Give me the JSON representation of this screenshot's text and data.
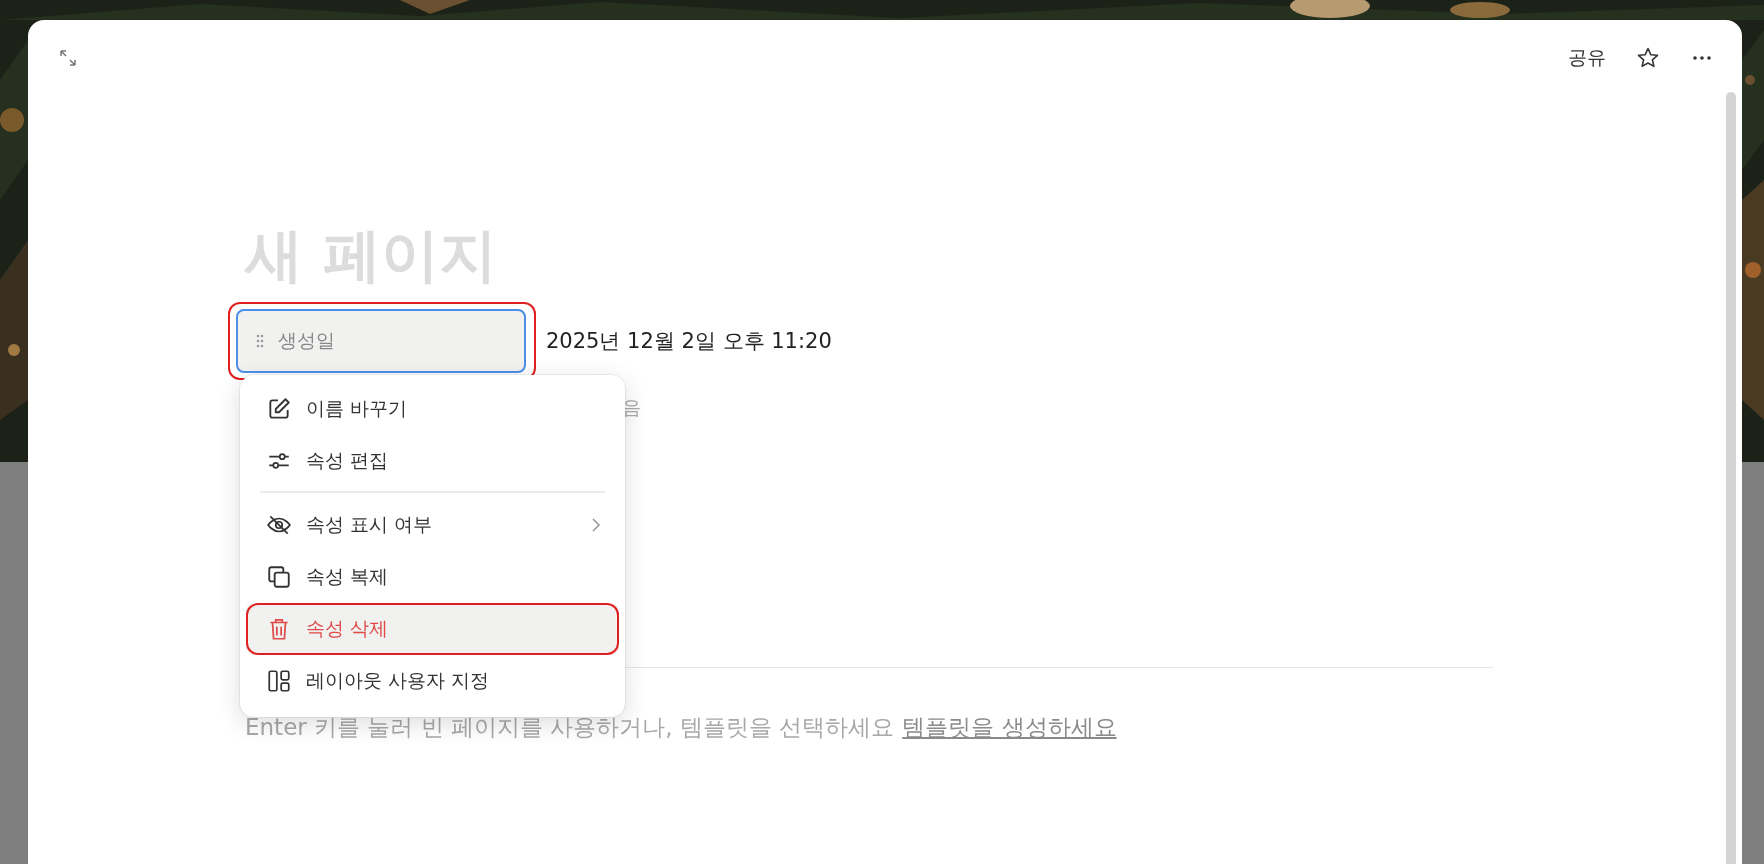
{
  "topbar": {
    "share": "공유"
  },
  "page": {
    "title": "새 페이지",
    "property": {
      "name": "생성일",
      "value": "2025년 12월 2일 오후 11:20",
      "focused": true,
      "highlighted": true
    },
    "hidden_fragment": "음",
    "hint": {
      "text": "Enter 키를 눌러 빈 페이지를 사용하거나, 템플릿을 선택하세요",
      "link": "템플릿을 생성하세요"
    }
  },
  "menu": {
    "sections": [
      {
        "items": [
          {
            "kind": "rename",
            "label": "이름 바꾸기",
            "selected": false,
            "highlighted": false,
            "submenu": false
          },
          {
            "kind": "edit",
            "label": "속성 편집",
            "selected": false,
            "highlighted": false,
            "submenu": false
          }
        ]
      },
      {
        "items": [
          {
            "kind": "visibility",
            "label": "속성 표시 여부",
            "selected": false,
            "highlighted": false,
            "submenu": true
          },
          {
            "kind": "duplicate",
            "label": "속성 복제",
            "selected": false,
            "highlighted": false,
            "submenu": false
          },
          {
            "kind": "delete",
            "label": "속성 삭제",
            "selected": true,
            "highlighted": true,
            "submenu": false
          },
          {
            "kind": "layout",
            "label": "레이아웃 사용자 지정",
            "selected": false,
            "highlighted": false,
            "submenu": false
          }
        ]
      }
    ]
  }
}
